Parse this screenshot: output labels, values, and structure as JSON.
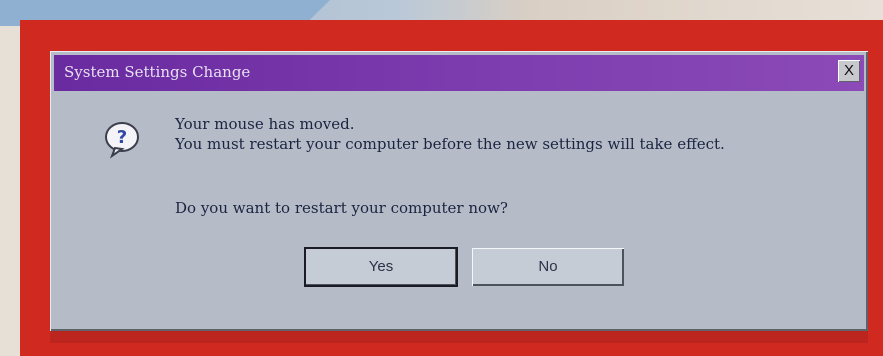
{
  "dialog": {
    "title": "System Settings Change",
    "close_label": "X",
    "message_lines": [
      "Your mouse has moved.",
      "You must restart your computer before the new settings will take effect."
    ],
    "question": "Do you want to restart your computer now?",
    "buttons": {
      "yes": "Yes",
      "no": "No"
    },
    "icon": "question-icon"
  },
  "colors": {
    "background_red": "#cf2b22",
    "titlebar_purple": "#7c3cae",
    "dialog_gray": "#b5bcc8"
  }
}
